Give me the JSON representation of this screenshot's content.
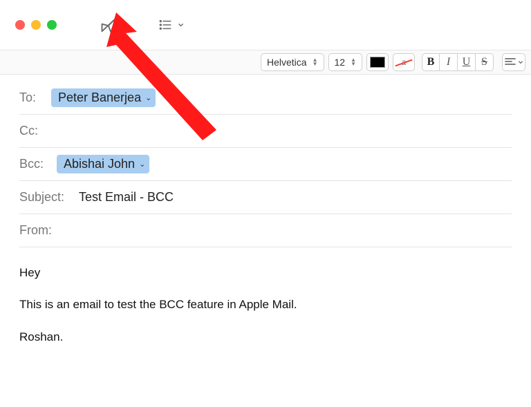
{
  "toolbar": {
    "font_name": "Helvetica",
    "font_size": "12",
    "bold": "B",
    "italic": "I",
    "underline": "U",
    "strike": "S"
  },
  "headers": {
    "to_label": "To:",
    "to_value": "Peter Banerjea",
    "cc_label": "Cc:",
    "bcc_label": "Bcc:",
    "bcc_value": "Abishai John",
    "subject_label": "Subject:",
    "subject_value": "Test Email - BCC",
    "from_label": "From:"
  },
  "body": {
    "line1": "Hey",
    "line2": "This is an email to test the BCC feature in Apple Mail.",
    "line3": "Roshan."
  },
  "annotation": {
    "points_to": "send-button",
    "color": "#ff1a1a"
  }
}
